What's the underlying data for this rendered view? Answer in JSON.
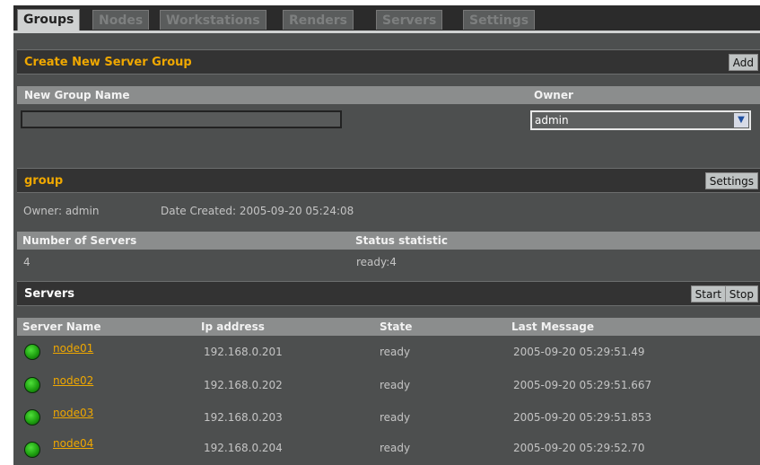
{
  "tabs": [
    "Groups",
    "Nodes",
    "Workstations",
    "Renders",
    "Servers",
    "Settings"
  ],
  "create": {
    "title": "Create New Server Group",
    "add_label": "Add",
    "name_header": "New Group Name",
    "owner_header": "Owner",
    "name_value": "",
    "owner_value": "admin"
  },
  "group": {
    "title": "group",
    "settings_label": "Settings",
    "owner_text": "Owner: admin",
    "date_text": "Date Created: 2005-09-20 05:24:08",
    "num_servers_header": "Number of Servers",
    "status_header": "Status statistic",
    "num_servers": "4",
    "status": "ready:4"
  },
  "servers": {
    "title": "Servers",
    "start_label": "Start",
    "stop_label": "Stop",
    "columns": [
      "Server Name",
      "Ip address",
      "State",
      "Last Message"
    ],
    "rows": [
      {
        "name": "node01",
        "ip": "192.168.0.201",
        "state": "ready",
        "msg": "2005-09-20 05:29:51.49"
      },
      {
        "name": "node02",
        "ip": "192.168.0.202",
        "state": "ready",
        "msg": "2005-09-20 05:29:51.667"
      },
      {
        "name": "node03",
        "ip": "192.168.0.203",
        "state": "ready",
        "msg": "2005-09-20 05:29:51.853"
      },
      {
        "name": "node04",
        "ip": "192.168.0.204",
        "state": "ready",
        "msg": "2005-09-20 05:29:52.70"
      }
    ]
  },
  "colors": {
    "accent": "#f0a800",
    "status_ok": "#1ea010",
    "background": "#4d4f4f"
  },
  "icons": {
    "status": "green-status-dot-icon",
    "dropdown": "chevron-down-icon"
  }
}
